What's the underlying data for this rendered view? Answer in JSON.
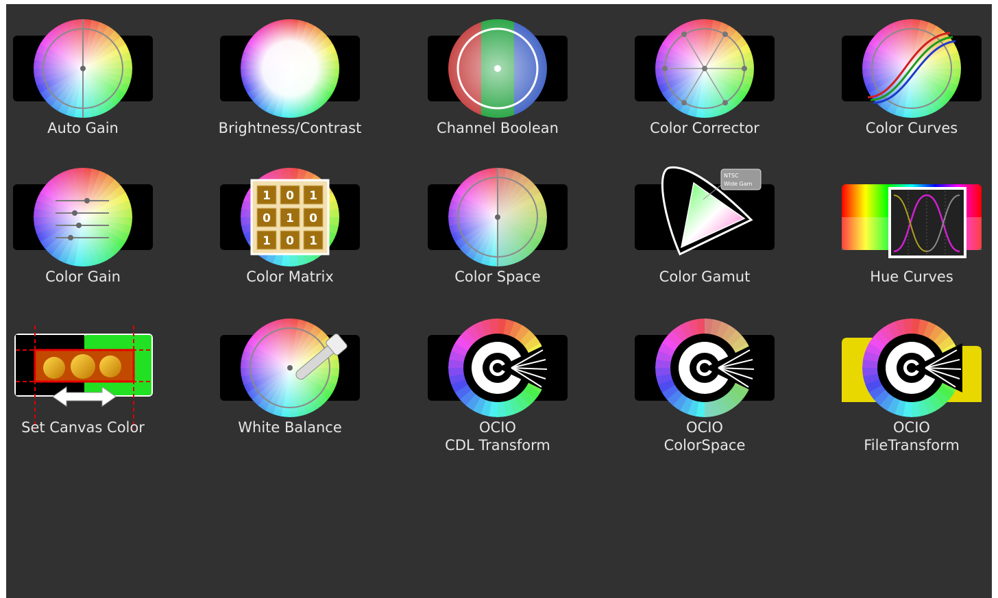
{
  "tools": [
    {
      "id": "auto-gain",
      "label": "Auto Gain",
      "icon": "auto-gain-icon"
    },
    {
      "id": "brightness-contrast",
      "label": "Brightness/Contrast",
      "icon": "brightness-contrast-icon"
    },
    {
      "id": "channel-boolean",
      "label": "Channel Boolean",
      "icon": "channel-boolean-icon"
    },
    {
      "id": "color-corrector",
      "label": "Color Corrector",
      "icon": "color-corrector-icon"
    },
    {
      "id": "color-curves",
      "label": "Color Curves",
      "icon": "color-curves-icon"
    },
    {
      "id": "color-gain",
      "label": "Color Gain",
      "icon": "color-gain-icon"
    },
    {
      "id": "color-matrix",
      "label": "Color Matrix",
      "icon": "color-matrix-icon",
      "matrix_digits": [
        "1",
        "0",
        "1",
        "0",
        "1",
        "0",
        "1",
        "0",
        "1"
      ]
    },
    {
      "id": "color-space",
      "label": "Color Space",
      "icon": "color-space-icon"
    },
    {
      "id": "color-gamut",
      "label": "Color Gamut",
      "icon": "color-gamut-icon",
      "badge_line1": "NTSC",
      "badge_line2": "Wide Gam"
    },
    {
      "id": "hue-curves",
      "label": "Hue Curves",
      "icon": "hue-curves-icon"
    },
    {
      "id": "set-canvas-color",
      "label": "Set Canvas Color",
      "icon": "set-canvas-color-icon"
    },
    {
      "id": "white-balance",
      "label": "White Balance",
      "icon": "white-balance-icon"
    },
    {
      "id": "ocio-cdl-transform",
      "label": "OCIO\nCDL Transform",
      "icon": "ocio-cdl-transform-icon"
    },
    {
      "id": "ocio-colorspace",
      "label": "OCIO\nColorSpace",
      "icon": "ocio-colorspace-icon"
    },
    {
      "id": "ocio-filetransform",
      "label": "OCIO\nFileTransform",
      "icon": "ocio-filetransform-icon"
    }
  ],
  "colors": {
    "panel_bg": "#313131",
    "label_text": "#e6e6e6",
    "icon_plate": "#000000"
  }
}
